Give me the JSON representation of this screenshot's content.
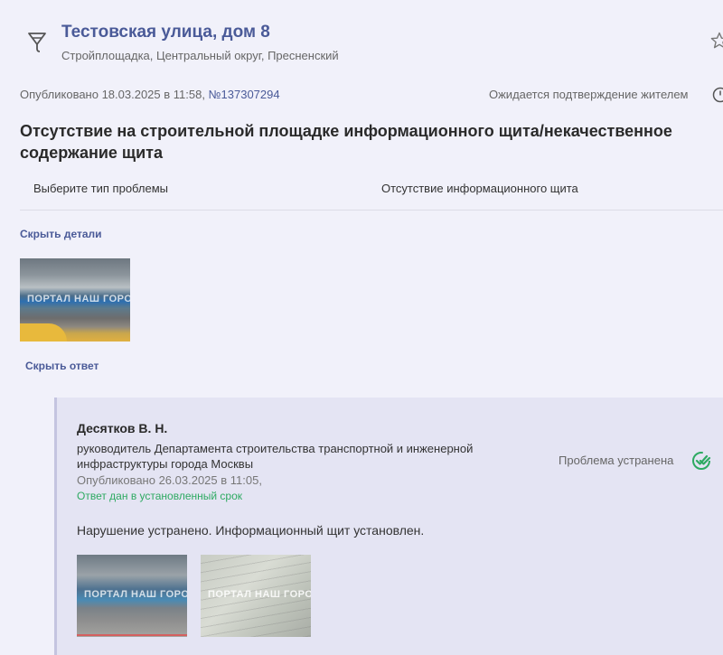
{
  "header": {
    "title": "Тестовская улица, дом 8",
    "subtitle": "Стройплощадка, Центральный округ, Пресненский"
  },
  "meta": {
    "published": "Опубликовано 18.03.2025 в 11:58,",
    "number": "№137307294",
    "status": "Ожидается подтверждение жителем"
  },
  "problem": {
    "heading": "Отсутствие на строительной площадке информационного щита/некачественное содержание щита",
    "field_label": "Выберите тип проблемы",
    "field_value": "Отсутствие информационного щита"
  },
  "links": {
    "hide_details": "Скрыть детали",
    "hide_answer": "Скрыть ответ"
  },
  "photos": {
    "watermark": "ПОРТАЛ НАШ ГОРОД"
  },
  "answer": {
    "author": "Десятков В. Н.",
    "position": "руководитель Департамента строительства транспортной и инженерной инфраструктуры города Москвы",
    "published": "Опубликовано 26.03.2025 в 11:05,",
    "deadline": "Ответ дан в установленный срок",
    "status": "Проблема устранена",
    "text": "Нарушение устранено. Информационный щит установлен."
  },
  "colors": {
    "accent": "#4a5a98",
    "success": "#2eaa62",
    "background": "#f1f1fa",
    "answer_bg": "#e4e4f3"
  },
  "icons": [
    "crane-icon",
    "star-icon",
    "clock-icon",
    "double-check-icon"
  ]
}
